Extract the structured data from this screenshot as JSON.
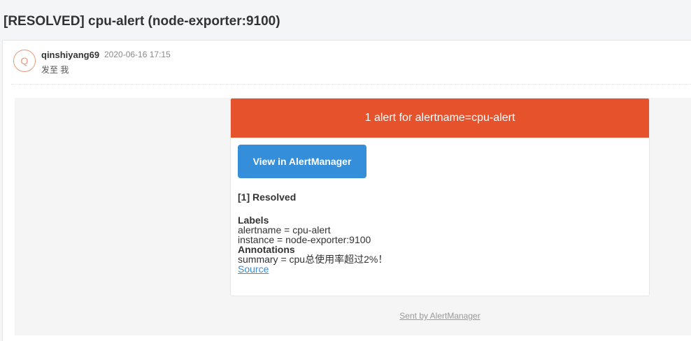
{
  "subject": "[RESOLVED] cpu-alert (node-exporter:9100)",
  "mail": {
    "avatar_letter": "Q",
    "sender": "qinshiyang69",
    "date": "2020-06-16 17:15",
    "recipient": "发至 我"
  },
  "alert": {
    "header": "1 alert for alertname=cpu-alert",
    "button_label": "View in AlertManager",
    "status": "[1] Resolved",
    "labels_title": "Labels",
    "labels": [
      "alertname = cpu-alert",
      "instance = node-exporter:9100"
    ],
    "annotations_title": "Annotations",
    "annotations": [
      "summary = cpu总使用率超过2%！"
    ],
    "source_link": "Source",
    "footer": "Sent by AlertManager"
  },
  "colors": {
    "header_bg": "#e6522c",
    "button_bg": "#348eda",
    "link": "#348eda"
  }
}
